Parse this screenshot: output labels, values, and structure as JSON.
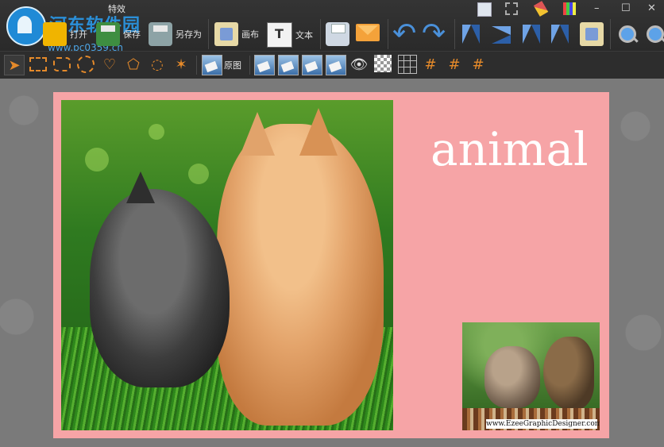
{
  "window": {
    "title": "特效"
  },
  "watermark": {
    "site_name": "河东软件园",
    "url": "www.pc0359.cn"
  },
  "toolbar": {
    "open_label": "打开",
    "save_label": "保存",
    "save_as_label": "另存为",
    "canvas_label": "画布",
    "text_label": "文本"
  },
  "toolbar2": {
    "original_label": "原图"
  },
  "canvas": {
    "title_text": "animal",
    "photo_caption": "www.EzeeGraphicDesigner.com"
  },
  "colors": {
    "card_background": "#f6a4a6",
    "accent_tool": "#e58a2a",
    "toolbar_bg": "#2b2b2b"
  },
  "icons": [
    "folder-icon",
    "save-icon",
    "save-as-icon",
    "canvas-icon",
    "text-icon",
    "print-icon",
    "mail-icon",
    "undo-icon",
    "redo-icon",
    "flip-vertical-icon",
    "flip-horizontal-icon",
    "rotate-left-icon",
    "rotate-right-icon",
    "crop-icon",
    "zoom-in-icon",
    "zoom-out-icon",
    "pointer-icon",
    "rect-select-icon",
    "rounded-rect-select-icon",
    "ellipse-select-icon",
    "heart-select-icon",
    "polygon-select-icon",
    "lasso-select-icon",
    "magic-wand-icon",
    "original-image-icon",
    "effect-icon",
    "red-eye-icon",
    "transparency-icon",
    "grid-icon",
    "hash-icon"
  ]
}
